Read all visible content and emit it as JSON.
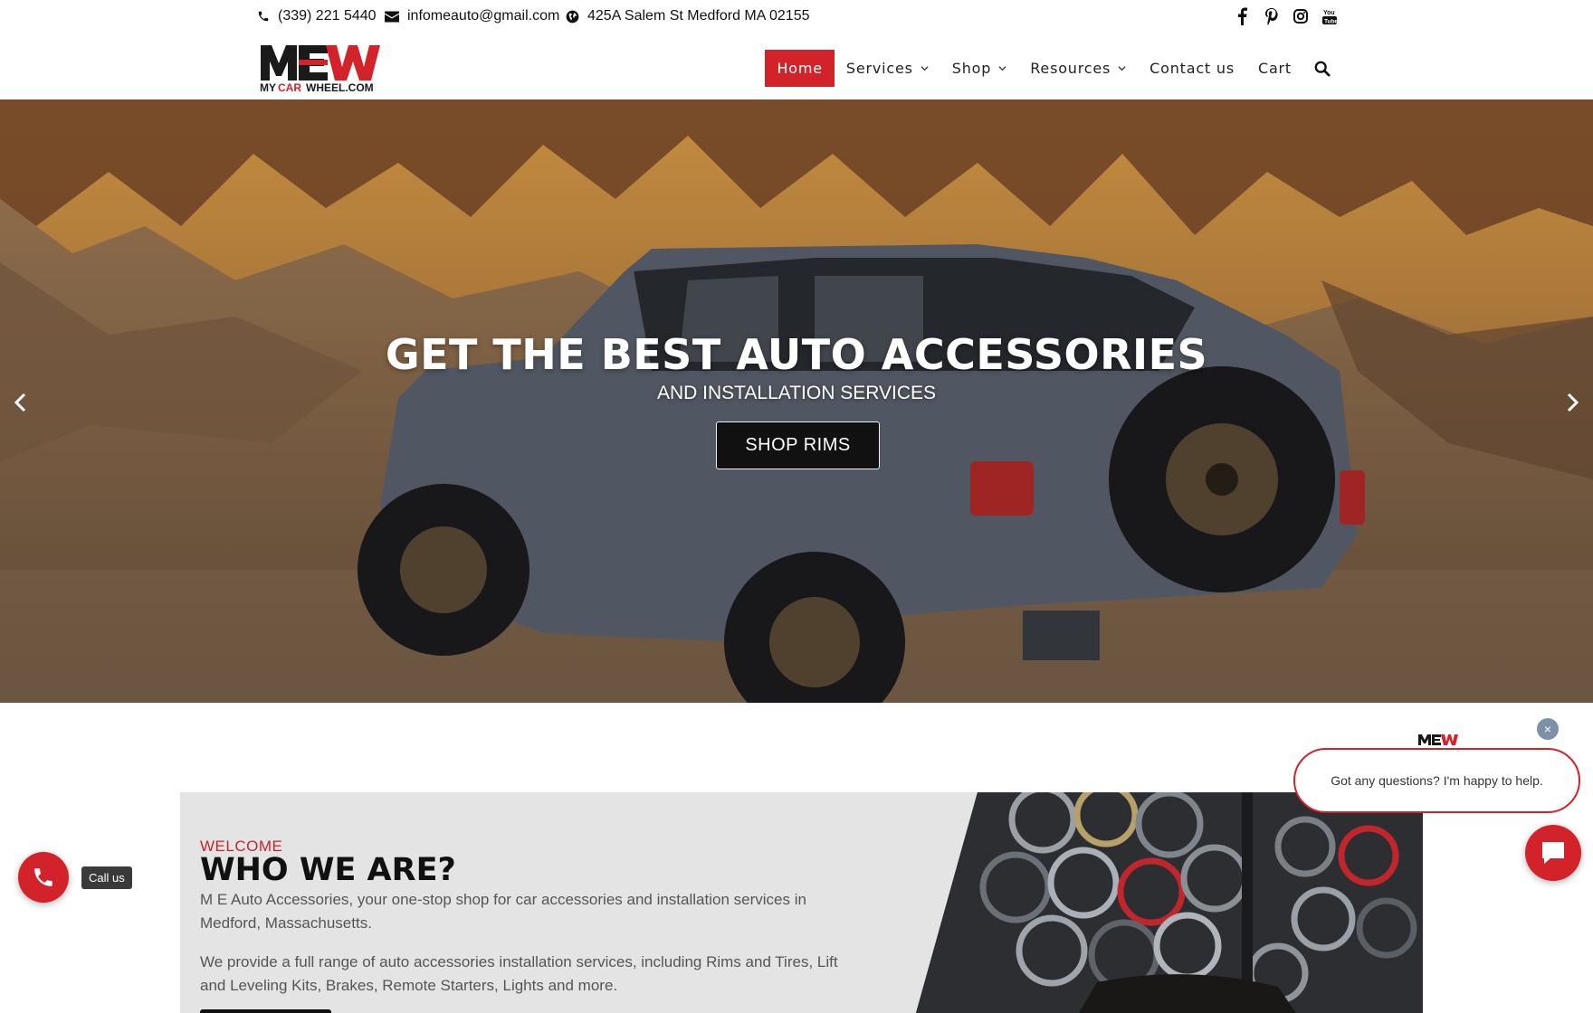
{
  "topbar": {
    "phone": "(339) 221 5440",
    "email": "infomeauto@gmail.com",
    "address": "425A Salem St Medford MA 02155",
    "social_icons": [
      "facebook-icon",
      "pinterest-icon",
      "instagram-icon",
      "youtube-icon"
    ]
  },
  "logo": {
    "big": "MEW",
    "small": "MYCARWHEEL.COM"
  },
  "nav": {
    "items": [
      {
        "label": "Home",
        "active": true
      },
      {
        "label": "Services",
        "dropdown": true
      },
      {
        "label": "Shop",
        "dropdown": true
      },
      {
        "label": "Resources",
        "dropdown": true
      },
      {
        "label": "Contact us"
      },
      {
        "label": "Cart"
      }
    ],
    "search_icon": "search-icon"
  },
  "hero": {
    "title": "GET THE BEST AUTO ACCESSORIES",
    "subtitle": "AND INSTALLATION SERVICES",
    "button": "SHOP RIMS"
  },
  "about": {
    "eyebrow": "WELCOME",
    "heading": "WHO WE ARE?",
    "p1": "M E Auto Accessories, your one-stop shop for car accessories and installation services in Medford, Massachusetts.",
    "p2": "We provide a full range of auto accessories installation services, including Rims and Tires, Lift and Leveling Kits, Brakes, Remote Starters, Lights and more."
  },
  "call": {
    "label": "Call us"
  },
  "chat": {
    "message": "Got any questions? I'm happy to help.",
    "close": "×"
  },
  "colors": {
    "accent": "#d2232a",
    "dark": "#111111",
    "panel": "#e4e4e4"
  }
}
